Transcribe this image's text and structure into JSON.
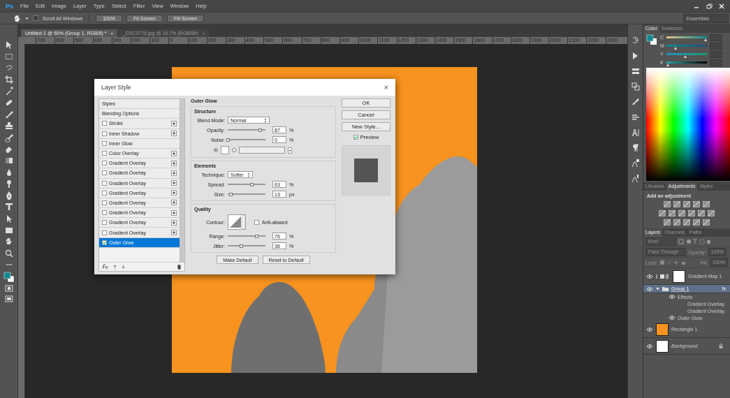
{
  "menubar": {
    "logo": "Ps",
    "menus": [
      "File",
      "Edit",
      "Image",
      "Layer",
      "Type",
      "Select",
      "Filter",
      "View",
      "Window",
      "Help"
    ]
  },
  "options_bar": {
    "scroll_all_windows": {
      "label": "Scroll All Windows",
      "checked": false
    },
    "buttons": [
      "100%",
      "Fit Screen",
      "Fill Screen"
    ],
    "workspace": "Essentials"
  },
  "document_tabs": [
    {
      "label": "Untitled-1 @ 50% (Group 1, RGB/8) *",
      "close": "×",
      "selected": true
    },
    {
      "label": "_DSC0776.jpg @ 16.7% (RGB/8#)",
      "close": "×",
      "selected": false
    }
  ],
  "ruler": [
    "700",
    "600",
    "500",
    "400",
    "300",
    "200",
    "100",
    "0",
    "100",
    "200",
    "300",
    "400",
    "500",
    "600",
    "700",
    "800",
    "900",
    "1000",
    "1100",
    "1200",
    "1300",
    "1400",
    "1500",
    "1600",
    "1700",
    "1800",
    "1900",
    "2000",
    "2100",
    "2200",
    "2300"
  ],
  "layer_style_dialog": {
    "title": "Layer Style",
    "close": "×",
    "styles_list": [
      {
        "label": "Styles",
        "kind": "header",
        "selected": false
      },
      {
        "label": "Blending Options",
        "kind": "header",
        "selected": false
      },
      {
        "label": "Stroke",
        "kind": "effect",
        "checked": false,
        "addable": true,
        "selected": false
      },
      {
        "label": "Inner Shadow",
        "kind": "effect",
        "checked": false,
        "addable": true,
        "selected": false
      },
      {
        "label": "Inner Glow",
        "kind": "effect",
        "checked": false,
        "addable": false,
        "selected": false
      },
      {
        "label": "Color Overlay",
        "kind": "effect",
        "checked": false,
        "addable": true,
        "selected": false
      },
      {
        "label": "Gradient Overlay",
        "kind": "effect",
        "checked": false,
        "addable": true,
        "selected": false
      },
      {
        "label": "Gradient Overlay",
        "kind": "effect",
        "checked": false,
        "addable": true,
        "selected": false
      },
      {
        "label": "Gradient Overlay",
        "kind": "effect",
        "checked": false,
        "addable": true,
        "selected": false
      },
      {
        "label": "Gradient Overlay",
        "kind": "effect",
        "checked": false,
        "addable": true,
        "selected": false
      },
      {
        "label": "Gradient Overlay",
        "kind": "effect",
        "checked": false,
        "addable": true,
        "selected": false
      },
      {
        "label": "Gradient Overlay",
        "kind": "effect",
        "checked": false,
        "addable": true,
        "selected": false
      },
      {
        "label": "Gradient Overlay",
        "kind": "effect",
        "checked": false,
        "addable": true,
        "selected": false
      },
      {
        "label": "Gradient Overlay",
        "kind": "effect",
        "checked": false,
        "addable": true,
        "selected": false
      },
      {
        "label": "Outer Glow",
        "kind": "effect",
        "checked": true,
        "addable": false,
        "selected": true
      }
    ],
    "section_title": "Outer Glow",
    "structure": {
      "title": "Structure",
      "blend_mode": {
        "label": "Blend Mode:",
        "value": "Normal"
      },
      "sliders": [
        {
          "label": "Opacity:",
          "level": 0.87,
          "value": "87",
          "unit": "%"
        },
        {
          "label": "Noise:",
          "level": 0.0,
          "value": "0",
          "unit": "%"
        }
      ],
      "fill_type": [
        {
          "kind": "color",
          "selected": true
        },
        {
          "kind": "gradient",
          "selected": false
        }
      ]
    },
    "elements": {
      "title": "Elements",
      "technique": {
        "label": "Technique:",
        "value": "Softer"
      },
      "sliders": [
        {
          "label": "Spread:",
          "level": 0.63,
          "value": "63",
          "unit": "%"
        },
        {
          "label": "Size:",
          "level": 0.08,
          "value": "13",
          "unit": "px"
        }
      ]
    },
    "quality": {
      "title": "Quality",
      "contour_label": "Contour:",
      "anti_aliased": {
        "label": "Anti-aliased",
        "checked": false
      },
      "sliders": [
        {
          "label": "Range:",
          "level": 0.76,
          "value": "76",
          "unit": "%"
        },
        {
          "label": "Jitter:",
          "level": 0.36,
          "value": "36",
          "unit": "%"
        }
      ]
    },
    "bottom_buttons": [
      "Make Default",
      "Reset to Default"
    ],
    "buttons": [
      "OK",
      "Cancel",
      "New Style..."
    ],
    "preview": {
      "label": "Preview",
      "checked": true
    }
  },
  "color_panel": {
    "tabs": [
      {
        "label": "Color",
        "selected": true
      },
      {
        "label": "Swatches",
        "selected": false
      }
    ],
    "channels": [
      {
        "label": "C",
        "level": 0.98
      },
      {
        "label": "M",
        "level": 0.24
      },
      {
        "label": "Y",
        "level": 0.48
      },
      {
        "label": "K",
        "level": 0.04
      }
    ]
  },
  "adjustments_panel": {
    "tabs": [
      {
        "label": "Libraries",
        "selected": false
      },
      {
        "label": "Adjustments",
        "selected": true
      },
      {
        "label": "Styles",
        "selected": false
      }
    ],
    "title": "Add an adjustment"
  },
  "layers_panel": {
    "tabs": [
      {
        "label": "Layers",
        "selected": true
      },
      {
        "label": "Channels",
        "selected": false
      },
      {
        "label": "Paths",
        "selected": false
      }
    ],
    "filter": "Kind",
    "blend_mode": "Pass Through",
    "opacity_label": "Opacity:",
    "opacity_value": "100%",
    "lock_label": "Lock:",
    "fill_label": "Fill:",
    "fill_value": "100%",
    "layers": [
      {
        "name": "Gradient Map 1",
        "kind": "adjustment",
        "visible": true,
        "selected": false
      },
      {
        "name": "Group 1",
        "kind": "group",
        "visible": true,
        "selected": true,
        "expanded": true,
        "fx": "fx",
        "children": [
          {
            "name": "Effects",
            "kind": "effects",
            "visible": true,
            "children": [
              {
                "name": "Gradient Overlay",
                "visible": false
              },
              {
                "name": "Gradient Overlay",
                "visible": false
              },
              {
                "name": "Outer Glow",
                "visible": true
              }
            ]
          }
        ]
      },
      {
        "name": "Rectangle 1",
        "kind": "shape",
        "visible": true,
        "selected": false
      },
      {
        "name": "Background",
        "kind": "background",
        "visible": true,
        "selected": false,
        "locked": true
      }
    ]
  }
}
